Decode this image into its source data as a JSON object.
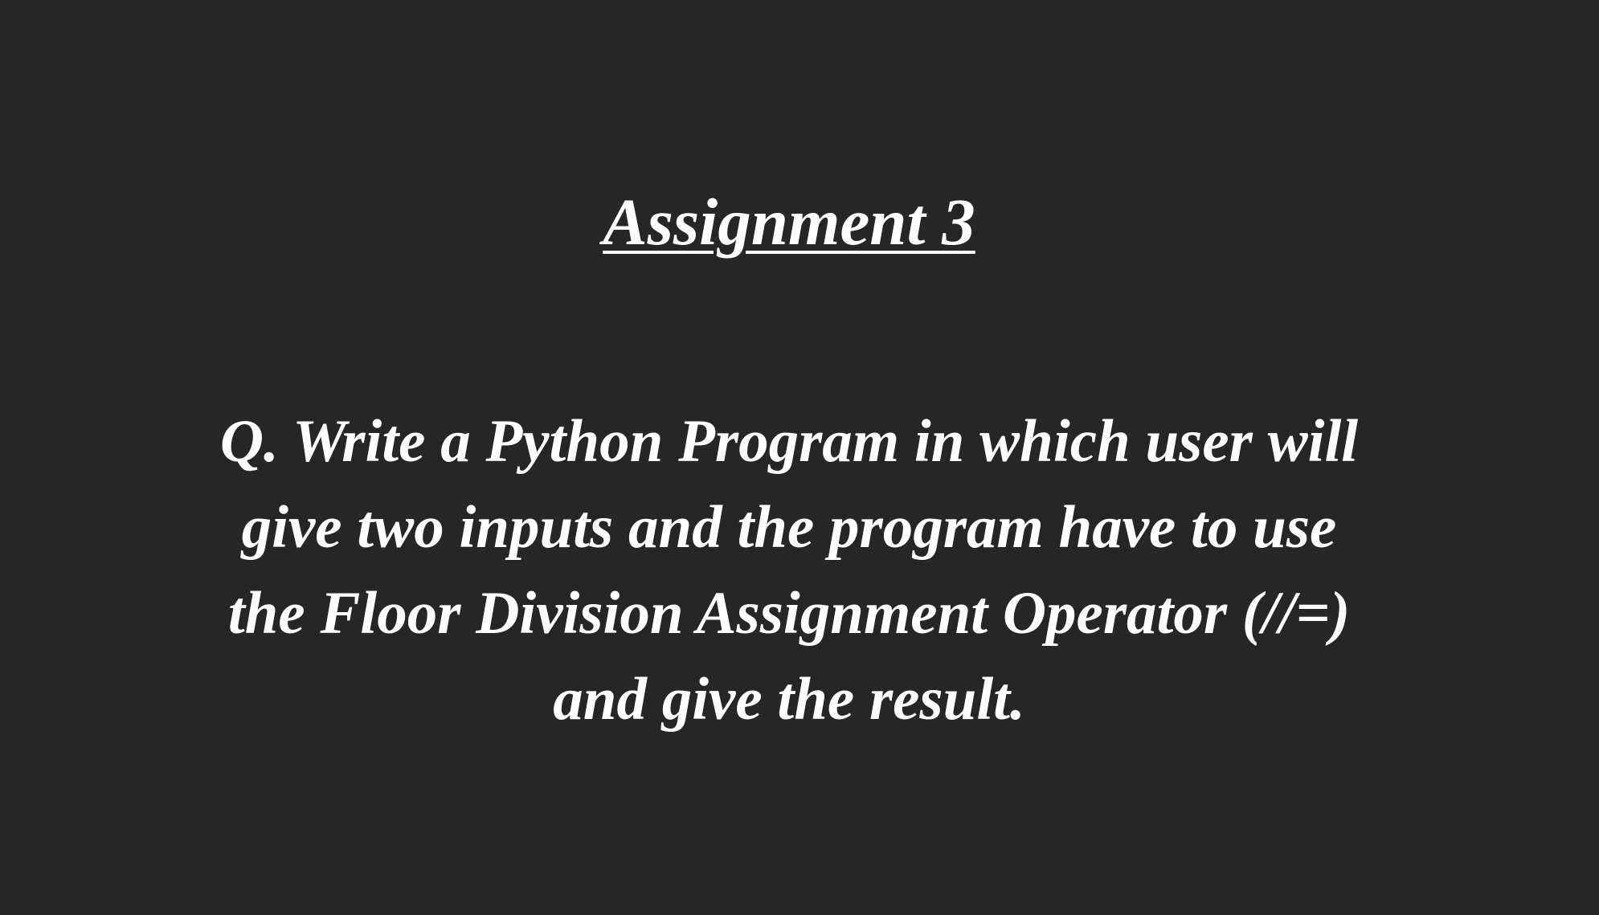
{
  "slide": {
    "title": "Assignment 3",
    "question_lines": [
      "Q. Write a Python Program in which user will",
      "give two inputs and the program have to use",
      "the Floor Division Assignment Operator (//=)",
      "and give the result."
    ],
    "colors": {
      "background": "#262626",
      "text": "#ffffff"
    }
  }
}
